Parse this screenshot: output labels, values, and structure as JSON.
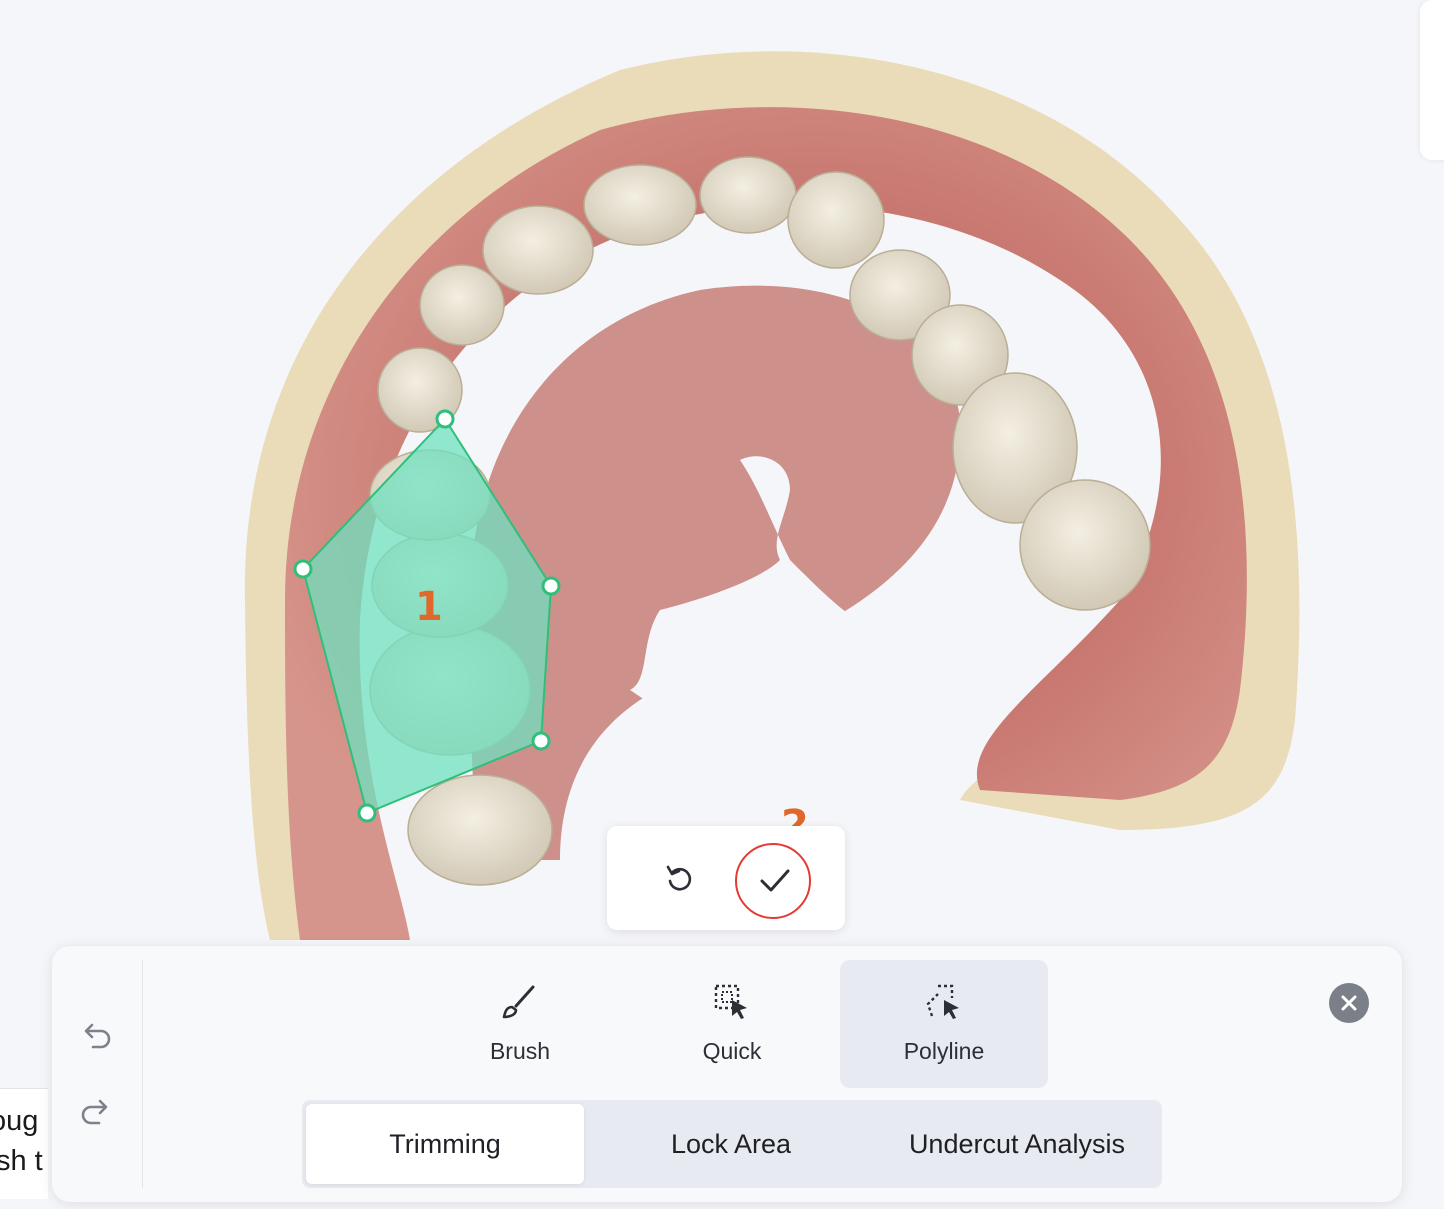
{
  "annotations": {
    "step1": "1",
    "step2": "2"
  },
  "side_panel": {
    "line1": "oug",
    "line2": "sh t"
  },
  "confirm_popup": {
    "reset_icon": "reset-icon",
    "apply_icon": "checkmark-icon"
  },
  "history": {
    "undo_icon": "undo-icon",
    "redo_icon": "redo-icon"
  },
  "tools": [
    {
      "label": "Brush",
      "icon": "brush-icon",
      "active": false
    },
    {
      "label": "Quick",
      "icon": "quick-select-icon",
      "active": false
    },
    {
      "label": "Polyline",
      "icon": "polyline-select-icon",
      "active": true
    }
  ],
  "close_icon": "close-icon",
  "mode_tabs": [
    {
      "label": "Trimming",
      "active": true
    },
    {
      "label": "Lock Area",
      "active": false
    },
    {
      "label": "Undercut Analysis",
      "active": false
    }
  ],
  "colors": {
    "selection_fill": "#6fe0bf",
    "selection_stroke": "#2fbf7a",
    "annotation": "#e0682a",
    "highlight_ring": "#e53935",
    "gum": "#c8746c",
    "tooth": "#e6dfcf",
    "model_base": "#eadcb8"
  }
}
